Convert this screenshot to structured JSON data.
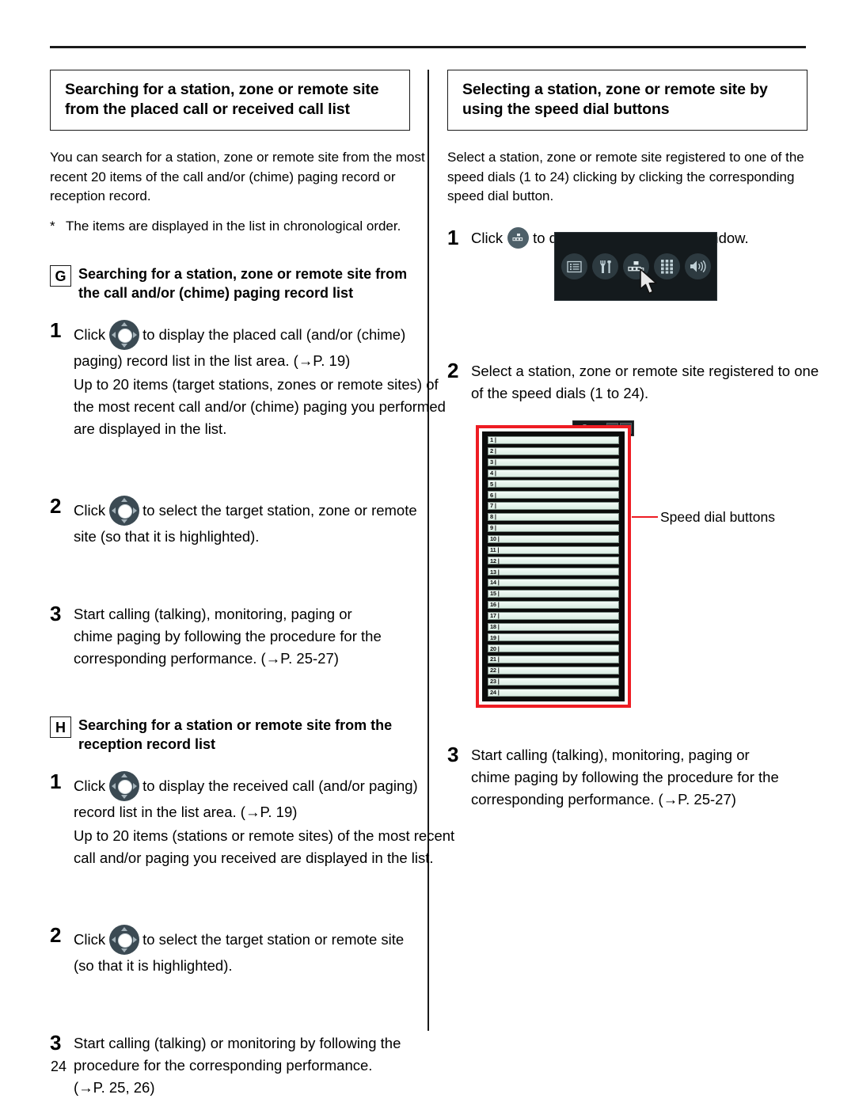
{
  "page": {
    "number": "24"
  },
  "left_column": {
    "section_heading": {
      "lines": [
        "Searching for a station, zone or remote site",
        "from the placed call or received call list"
      ]
    },
    "intro": {
      "lines": [
        "You can search for a station, zone or remote site from the most",
        "recent 20 items of the call and/or (chime) paging record or",
        "reception record."
      ]
    },
    "note": {
      "marker": "*",
      "text": "The items are displayed in the list in chronological order."
    },
    "subsection_g": {
      "letter": "G",
      "heading_lines": [
        "Searching for a station, zone or remote site from",
        "the call and/or (chime) paging record list"
      ],
      "steps": [
        {
          "num": "1",
          "before_icon": "Click",
          "icon": "dpad-icon",
          "after_icon": "to display the placed call (and/or (chime)",
          "line2": "paging) record list in the list area. (→P. 19)",
          "sub_lines": [
            "Up to 20 items (target stations, zones or remote sites) of",
            "the most recent call and/or (chime) paging you performed",
            "are displayed in the list."
          ]
        },
        {
          "num": "2",
          "before_icon": "Click",
          "icon": "dpad-icon",
          "after_icon": "to select the target station, zone or remote",
          "line2": "site (so that it is highlighted).",
          "sub_lines": []
        },
        {
          "num": "3",
          "lines": [
            "Start calling (talking), monitoring, paging or",
            "chime paging by following the procedure for the",
            "corresponding performance. (→P. 25-27)"
          ]
        }
      ]
    },
    "subsection_h": {
      "letter": "H",
      "heading_lines": [
        "Searching for a station or remote site from the",
        "reception record list"
      ],
      "steps": [
        {
          "num": "1",
          "before_icon": "Click",
          "icon": "dpad-icon",
          "after_icon": "to display the received call (and/or paging)",
          "line2": "record list in the list area. (→P. 19)",
          "sub_lines": [
            "Up to 20 items (stations or remote sites) of the most recent",
            "call and/or paging you received are displayed in the list."
          ]
        },
        {
          "num": "2",
          "before_icon": "Click",
          "icon": "dpad-icon",
          "after_icon": "to select the target station or remote site",
          "line2": "(so that it is highlighted).",
          "sub_lines": []
        },
        {
          "num": "3",
          "lines": [
            "Start calling (talking) or monitoring by following the",
            "procedure for the corresponding performance.",
            "(→P. 25, 26)"
          ]
        }
      ]
    }
  },
  "right_column": {
    "section_heading": {
      "lines": [
        "Selecting a station, zone or remote site by",
        "using the speed dial buttons"
      ]
    },
    "intro": {
      "lines": [
        "Select a station, zone or remote site registered to one of the",
        "speed dials (1 to 24) clicking by clicking the corresponding",
        "speed dial button."
      ]
    },
    "step1": {
      "num": "1",
      "before_icon": "Click",
      "icon": "speed-dial-icon",
      "after_icon": "to display the Speed dial window."
    },
    "toolbar_figure": {
      "icons": [
        "list-icon",
        "tools-icon",
        "speed-dial-icon",
        "keypad-icon",
        "speaker-icon"
      ],
      "cursor": "mouse-pointer-icon"
    },
    "step2": {
      "num": "2",
      "lines": [
        "Select a station, zone or remote site registered to one",
        "of the speed dials (1 to 24)."
      ]
    },
    "speed_dial_window": {
      "rows": [
        "1",
        "2",
        "3",
        "4",
        "5",
        "6",
        "7",
        "8",
        "9",
        "10",
        "11",
        "12",
        "13",
        "14",
        "15",
        "16",
        "17",
        "18",
        "19",
        "20",
        "21",
        "22",
        "23",
        "24"
      ],
      "title_icon": "speed-dial-icon",
      "minimize_label": "–",
      "close_label": "✕",
      "highlight_color": "#ee1c23"
    },
    "callout": {
      "label": "Speed dial buttons",
      "line_color": "#ee1c23"
    },
    "step3": {
      "num": "3",
      "lines": [
        "Start calling (talking), monitoring, paging or",
        "chime paging by following the procedure for the",
        "corresponding performance. (→P. 25-27)"
      ]
    }
  }
}
